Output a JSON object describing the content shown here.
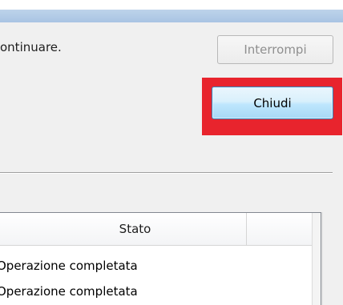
{
  "dialog": {
    "message": "ontinuare."
  },
  "buttons": {
    "interrompi_label": "Interrompi",
    "chiudi_label": "Chiudi"
  },
  "list": {
    "columns": [
      "Stato",
      ""
    ],
    "rows": [
      {
        "stato": "Operazione completata"
      },
      {
        "stato": "Operazione completata"
      }
    ]
  },
  "colors": {
    "highlight": "#e8242d",
    "chiudi_border": "#3c7fb1",
    "title_bar": "#bdd3ea"
  }
}
